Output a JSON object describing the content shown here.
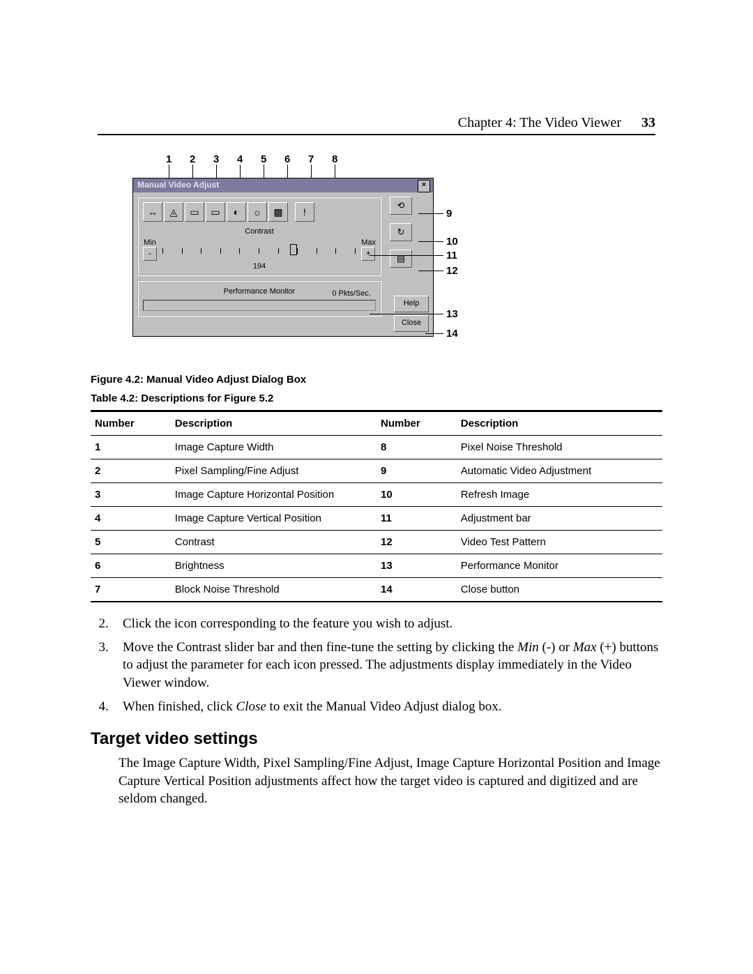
{
  "header": {
    "chapter": "Chapter 4: The Video Viewer",
    "page_number": "33"
  },
  "figure": {
    "caption": "Figure 4.2: Manual Video Adjust Dialog Box",
    "dialog_title": "Manual Video Adjust",
    "close_x": "×",
    "min_label": "Min",
    "max_label": "Max",
    "contrast_label": "Contrast",
    "slider_value": "194",
    "perf_label": "Performance Monitor",
    "perf_value": "0  Pkts/Sec.",
    "help_btn": "Help",
    "close_btn": "Close",
    "callouts_top": [
      "1",
      "2",
      "3",
      "4",
      "5",
      "6",
      "7",
      "8"
    ],
    "callouts_right": [
      "9",
      "10",
      "11",
      "12",
      "13",
      "14"
    ]
  },
  "table": {
    "caption": "Table 4.2: Descriptions for Figure 5.2",
    "headers": {
      "num": "Number",
      "desc": "Description"
    },
    "rows": [
      {
        "n1": "1",
        "d1": "Image Capture Width",
        "n2": "8",
        "d2": "Pixel Noise Threshold"
      },
      {
        "n1": "2",
        "d1": "Pixel Sampling/Fine Adjust",
        "n2": "9",
        "d2": "Automatic Video Adjustment"
      },
      {
        "n1": "3",
        "d1": "Image Capture Horizontal Position",
        "n2": "10",
        "d2": "Refresh Image"
      },
      {
        "n1": "4",
        "d1": "Image Capture Vertical Position",
        "n2": "11",
        "d2": "Adjustment bar"
      },
      {
        "n1": "5",
        "d1": "Contrast",
        "n2": "12",
        "d2": "Video Test Pattern"
      },
      {
        "n1": "6",
        "d1": "Brightness",
        "n2": "13",
        "d2": "Performance Monitor"
      },
      {
        "n1": "7",
        "d1": "Block Noise Threshold",
        "n2": "14",
        "d2": "Close button"
      }
    ]
  },
  "steps": {
    "s2": "Click the icon corresponding to the feature you wish to adjust.",
    "s3_a": "Move the Contrast slider bar and then fine-tune the setting by clicking the ",
    "s3_min": "Min",
    "s3_mid1": " (-) or ",
    "s3_max": "Max",
    "s3_b": " (+) buttons to adjust the parameter for each icon pressed. The adjustments display immediately in the Video Viewer window.",
    "s4_a": "When finished, click ",
    "s4_close": "Close",
    "s4_b": " to exit the Manual Video Adjust dialog box."
  },
  "section": {
    "heading": "Target video settings",
    "para": "The Image Capture Width, Pixel Sampling/Fine Adjust, Image Capture Horizontal Position and Image Capture Vertical Position adjustments affect how the target video is captured and digitized and are seldom changed."
  }
}
